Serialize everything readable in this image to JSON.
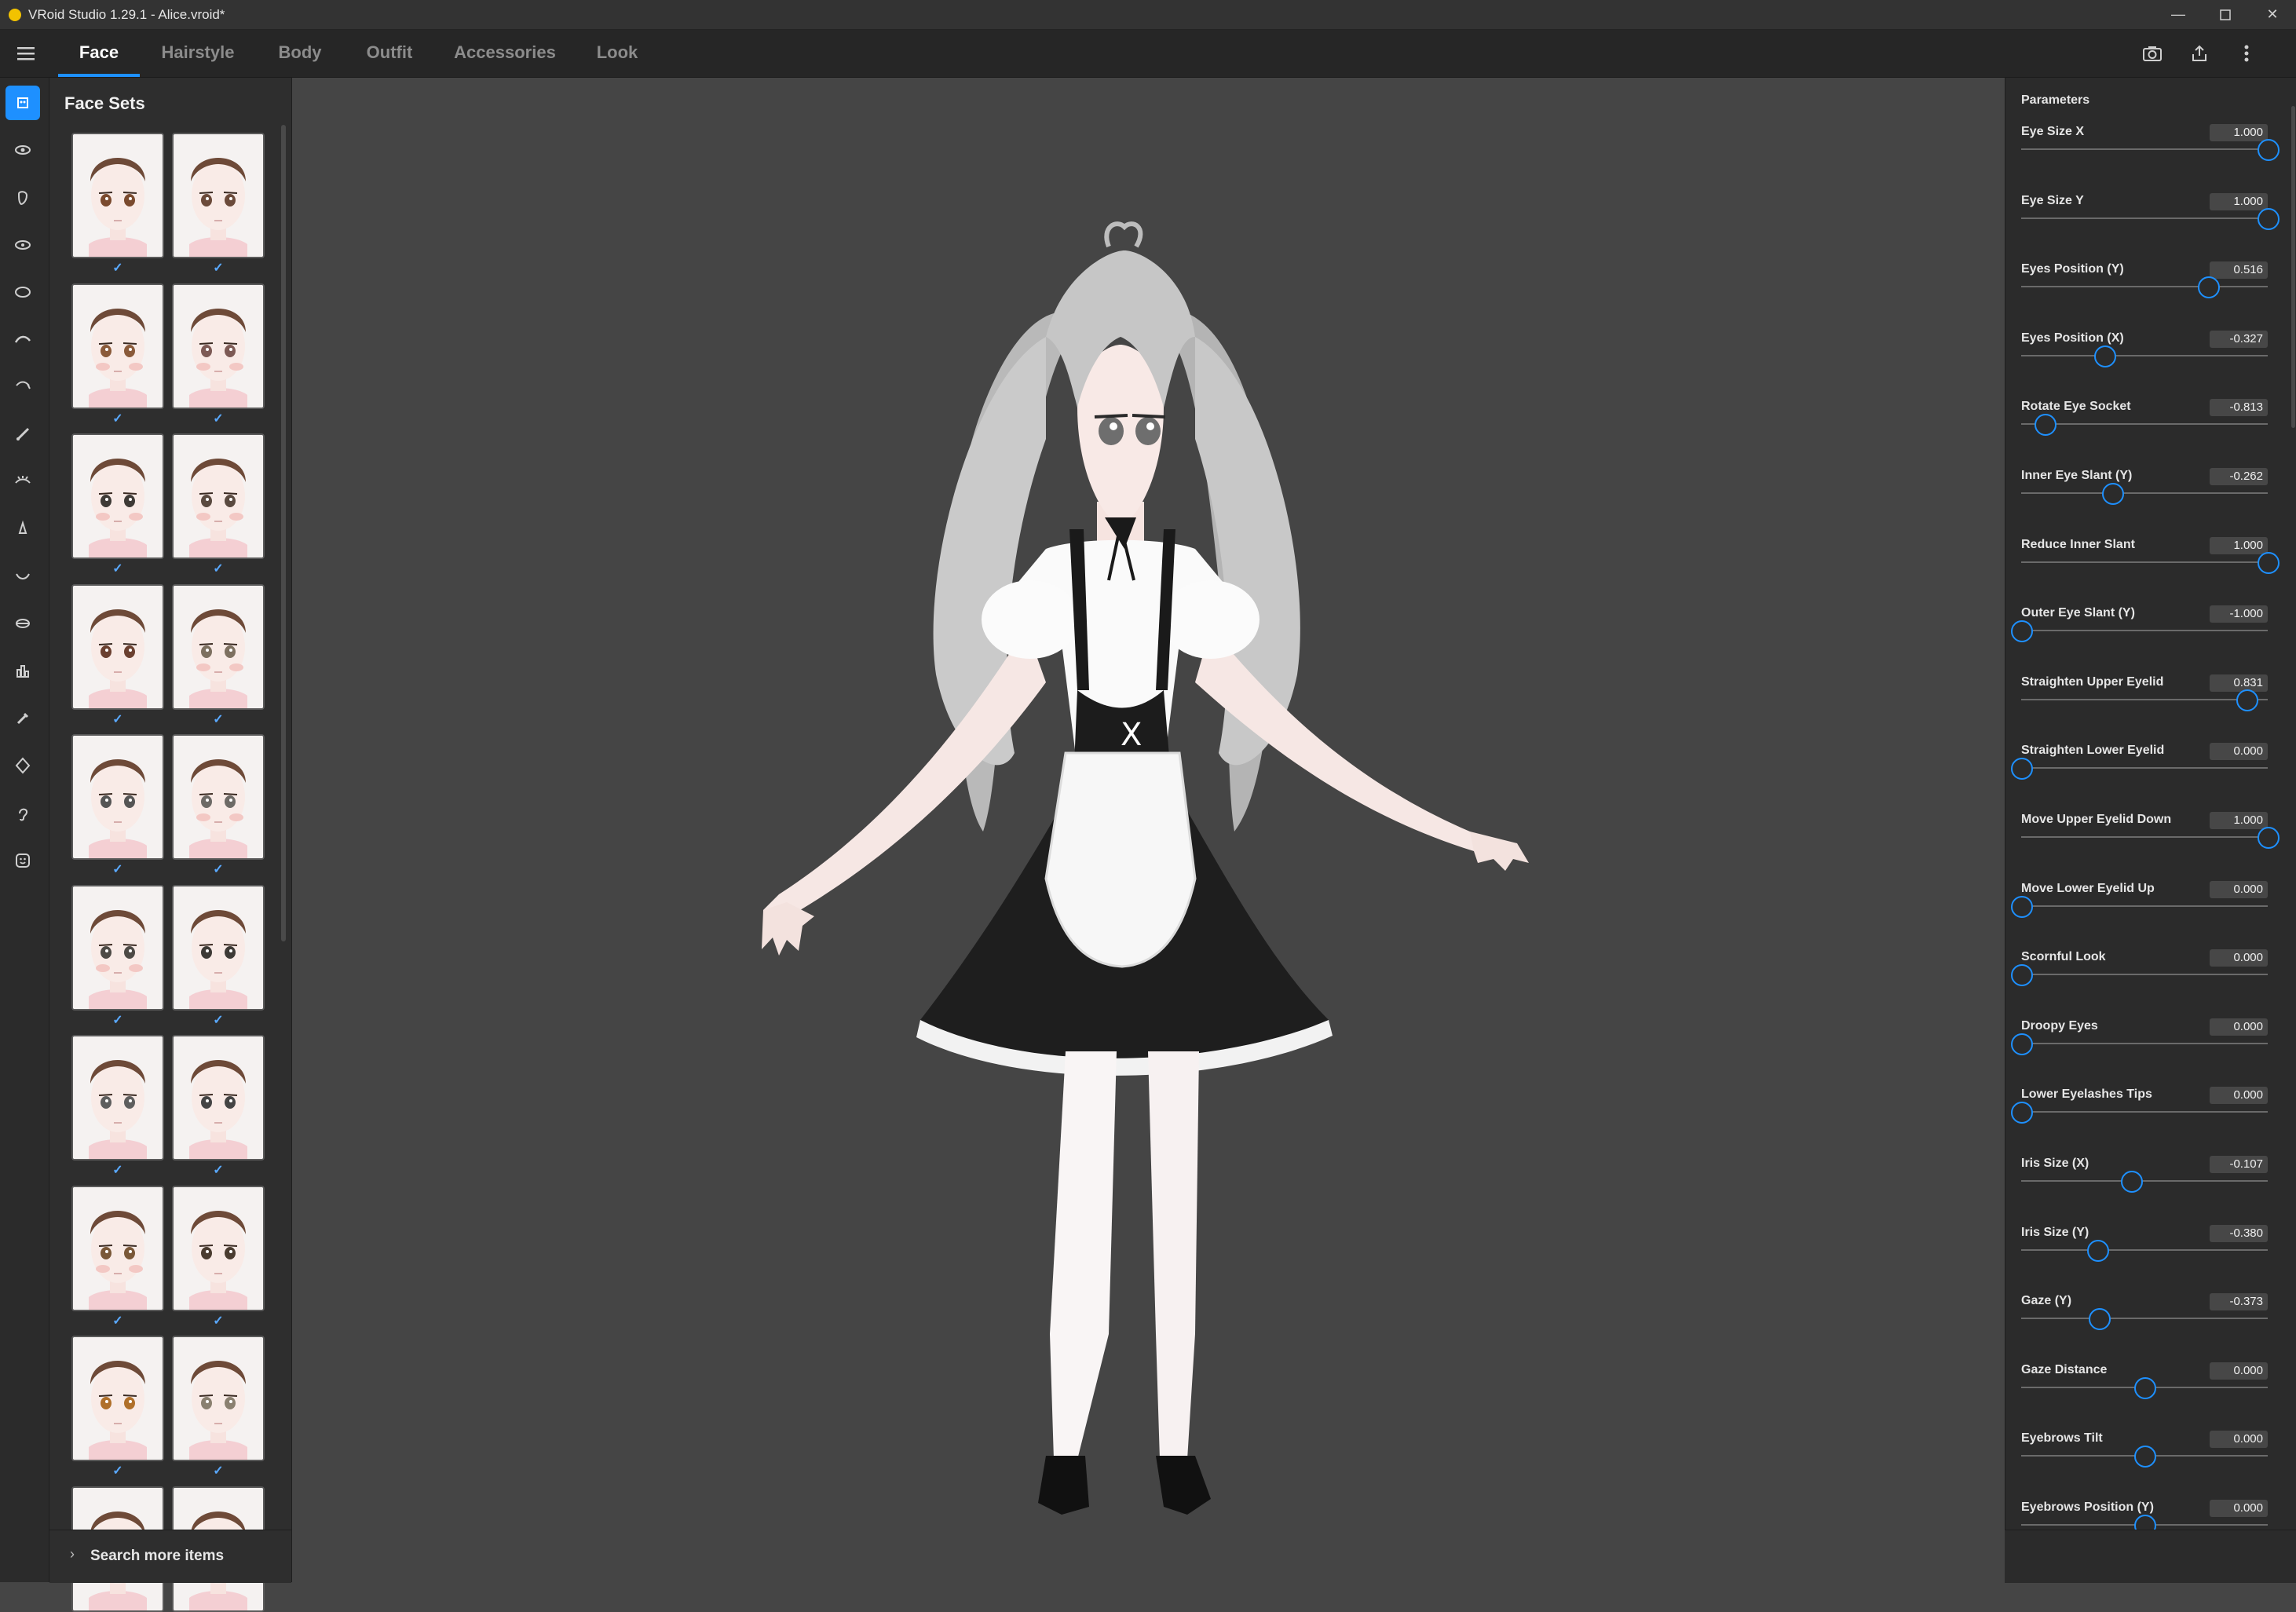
{
  "window": {
    "title": "VRoid Studio 1.29.1 - Alice.vroid*",
    "controls": [
      "minimize",
      "maximize",
      "close"
    ]
  },
  "tabs": [
    {
      "label": "Face",
      "active": true
    },
    {
      "label": "Hairstyle",
      "active": false
    },
    {
      "label": "Body",
      "active": false
    },
    {
      "label": "Outfit",
      "active": false
    },
    {
      "label": "Accessories",
      "active": false
    },
    {
      "label": "Look",
      "active": false
    }
  ],
  "toolbar_icons": [
    "camera-icon",
    "export-icon",
    "more-vertical-icon"
  ],
  "sidebar_icons": [
    "face-set-icon",
    "eye-icon",
    "face-shape-icon",
    "eyeline-icon",
    "iris-icon",
    "eyebrow-icon",
    "eyelash-icon",
    "brush-icon",
    "eyelid-icon",
    "nose-icon",
    "mouth-icon",
    "lips-icon",
    "teeth-icon",
    "ear-icon",
    "face-outline-icon",
    "ear-shape-icon",
    "expression-icon"
  ],
  "accent_color": "#1e90ff",
  "face_sets": {
    "title": "Face Sets",
    "items": [
      {
        "eye": "#7a4a2e",
        "blush": false,
        "checked": true
      },
      {
        "eye": "#6b4a3a",
        "blush": false,
        "checked": true
      },
      {
        "eye": "#8a5a3a",
        "blush": true,
        "checked": true
      },
      {
        "eye": "#7d5a55",
        "blush": true,
        "checked": true
      },
      {
        "eye": "#3e3a36",
        "blush": true,
        "checked": true
      },
      {
        "eye": "#5a4a40",
        "blush": true,
        "checked": true
      },
      {
        "eye": "#6b4030",
        "blush": false,
        "checked": true
      },
      {
        "eye": "#7d7060",
        "blush": true,
        "checked": true
      },
      {
        "eye": "#555555",
        "blush": false,
        "checked": true
      },
      {
        "eye": "#6d6a66",
        "blush": true,
        "checked": true
      },
      {
        "eye": "#4d4a46",
        "blush": true,
        "checked": true
      },
      {
        "eye": "#3d3a36",
        "blush": false,
        "checked": true
      },
      {
        "eye": "#5e5e5e",
        "blush": false,
        "checked": true
      },
      {
        "eye": "#444444",
        "blush": false,
        "checked": true
      },
      {
        "eye": "#7a5838",
        "blush": true,
        "checked": true
      },
      {
        "eye": "#4a3c30",
        "blush": false,
        "checked": true
      },
      {
        "eye": "#b0702a",
        "blush": false,
        "checked": true
      },
      {
        "eye": "#8a8070",
        "blush": false,
        "checked": true
      },
      {
        "eye": "#7a4a2e",
        "blush": false,
        "checked": false
      },
      {
        "eye": "#6b4a3a",
        "blush": false,
        "checked": false
      }
    ],
    "search_label": "Search more items"
  },
  "parameters": {
    "title": "Parameters",
    "range": [
      -1,
      1
    ],
    "items": [
      {
        "label": "Eye Size X",
        "value": "1.000",
        "position": 1.0
      },
      {
        "label": "Eye Size Y",
        "value": "1.000",
        "position": 1.0
      },
      {
        "label": "Eyes Position (Y)",
        "value": "0.516",
        "position": 0.758
      },
      {
        "label": "Eyes Position (X)",
        "value": "-0.327",
        "position": 0.337
      },
      {
        "label": "Rotate Eye Socket",
        "value": "-0.813",
        "position": 0.094
      },
      {
        "label": "Inner Eye Slant (Y)",
        "value": "-0.262",
        "position": 0.369
      },
      {
        "label": "Reduce Inner Slant",
        "value": "1.000",
        "position": 1.0
      },
      {
        "label": "Outer Eye Slant (Y)",
        "value": "-1.000",
        "position": 0.0
      },
      {
        "label": "Straighten Upper Eyelid",
        "value": "0.831",
        "position": 0.915
      },
      {
        "label": "Straighten Lower Eyelid",
        "value": "0.000",
        "position": 0.0
      },
      {
        "label": "Move Upper Eyelid Down",
        "value": "1.000",
        "position": 1.0
      },
      {
        "label": "Move Lower Eyelid Up",
        "value": "0.000",
        "position": 0.0
      },
      {
        "label": "Scornful Look",
        "value": "0.000",
        "position": 0.0
      },
      {
        "label": "Droopy Eyes",
        "value": "0.000",
        "position": 0.0
      },
      {
        "label": "Lower Eyelashes Tips",
        "value": "0.000",
        "position": 0.0
      },
      {
        "label": "Iris Size (X)",
        "value": "-0.107",
        "position": 0.447
      },
      {
        "label": "Iris Size (Y)",
        "value": "-0.380",
        "position": 0.31
      },
      {
        "label": "Gaze (Y)",
        "value": "-0.373",
        "position": 0.314
      },
      {
        "label": "Gaze Distance",
        "value": "0.000",
        "position": 0.5
      },
      {
        "label": "Eyebrows Tilt",
        "value": "0.000",
        "position": 0.5
      },
      {
        "label": "Eyebrows Position (Y)",
        "value": "0.000",
        "position": 0.5
      }
    ]
  }
}
